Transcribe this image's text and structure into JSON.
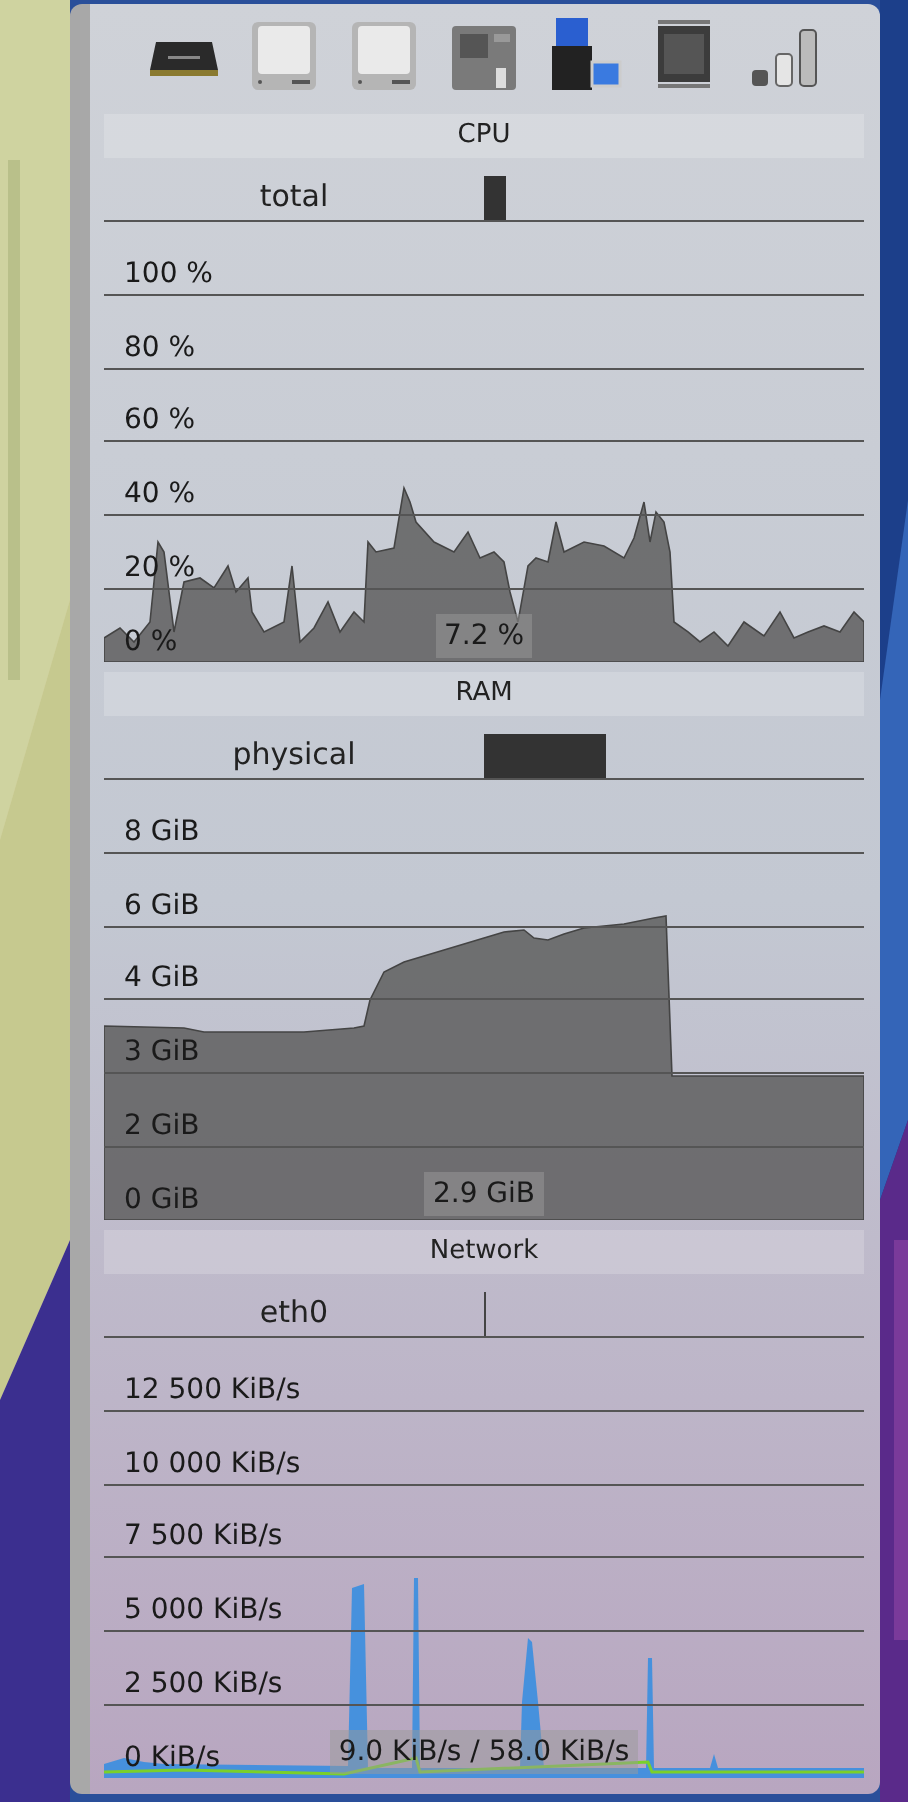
{
  "sections": [
    {
      "kind": "cpu",
      "title": "CPU",
      "sensor": "total",
      "ticks": [
        "100 %",
        "80 %",
        "60 %",
        "40 %",
        "20 %",
        "0 %"
      ],
      "value": "7.2 %"
    },
    {
      "kind": "ram",
      "title": "RAM",
      "sensor": "physical",
      "ticks": [
        "8 GiB",
        "6 GiB",
        "4 GiB",
        "3 GiB",
        "2 GiB",
        "0 GiB"
      ],
      "value": "2.9 GiB"
    },
    {
      "kind": "network",
      "title": "Network",
      "sensor": "eth0",
      "ticks": [
        "12 500 KiB/s",
        "10 000 KiB/s",
        "7 500 KiB/s",
        "5 000 KiB/s",
        "2 500 KiB/s",
        "0 KiB/s"
      ],
      "value": "9.0 KiB/s / 58.0 KiB/s"
    }
  ]
}
